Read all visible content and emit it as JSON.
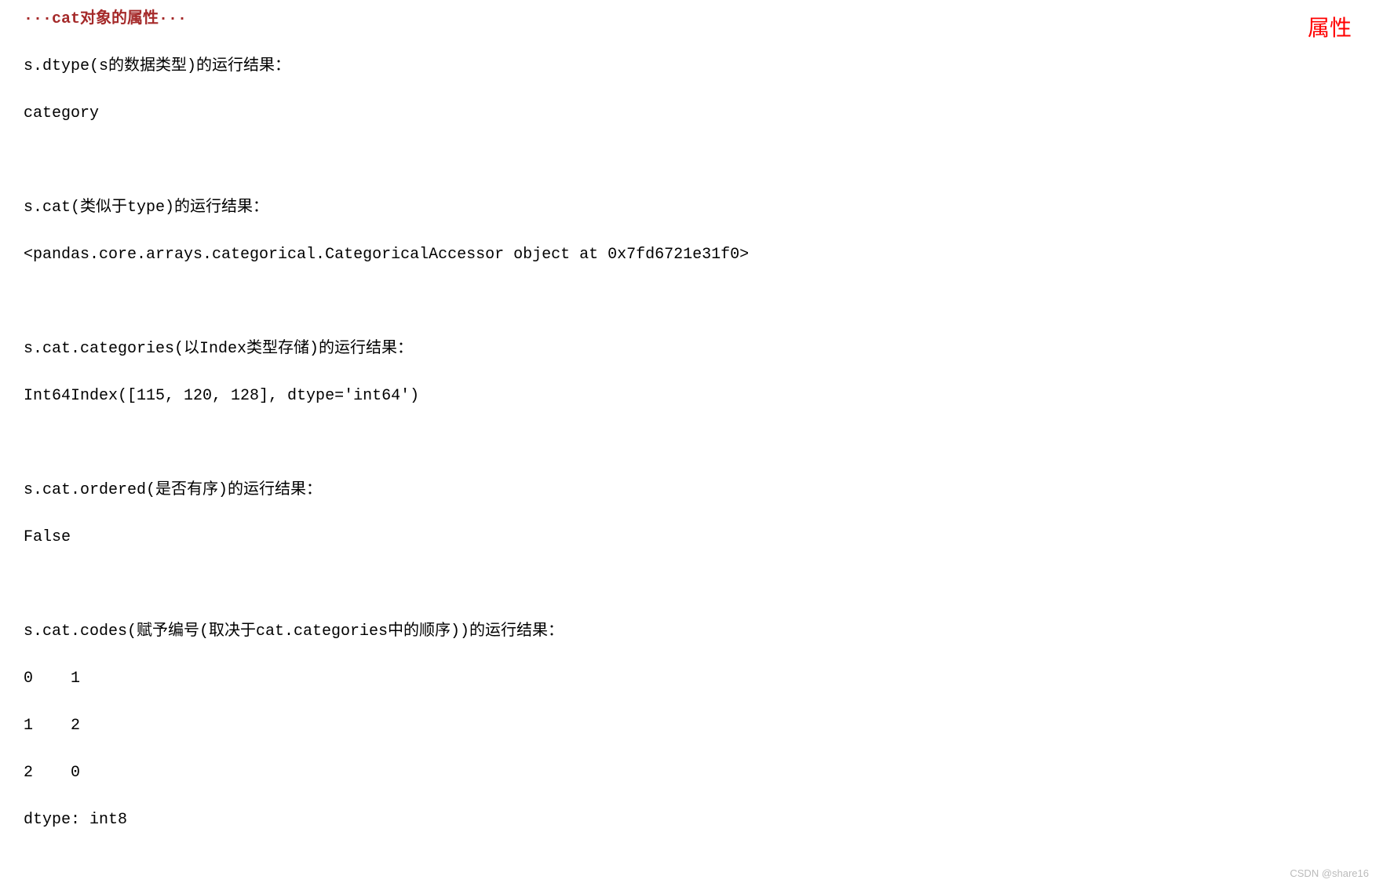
{
  "header": {
    "title": "···cat对象的属性···",
    "topRightLabel": "属性"
  },
  "blocks": {
    "dtype": {
      "label": "s.dtype(s的数据类型)的运行结果：",
      "result": "category"
    },
    "cat": {
      "label": "s.cat(类似于type)的运行结果：",
      "result": "<pandas.core.arrays.categorical.CategoricalAccessor object at 0x7fd6721e31f0>"
    },
    "categories": {
      "label": "s.cat.categories(以Index类型存储)的运行结果：",
      "result": "Int64Index([115, 120, 128], dtype='int64')"
    },
    "ordered": {
      "label": "s.cat.ordered(是否有序)的运行结果：",
      "result": "False"
    },
    "codes": {
      "label": "s.cat.codes(赋予编号(取决于cat.categories中的顺序))的运行结果：",
      "line1": "0    1",
      "line2": "1    2",
      "line3": "2    0",
      "line4": "dtype: int8"
    }
  },
  "watermark": "CSDN @share16"
}
